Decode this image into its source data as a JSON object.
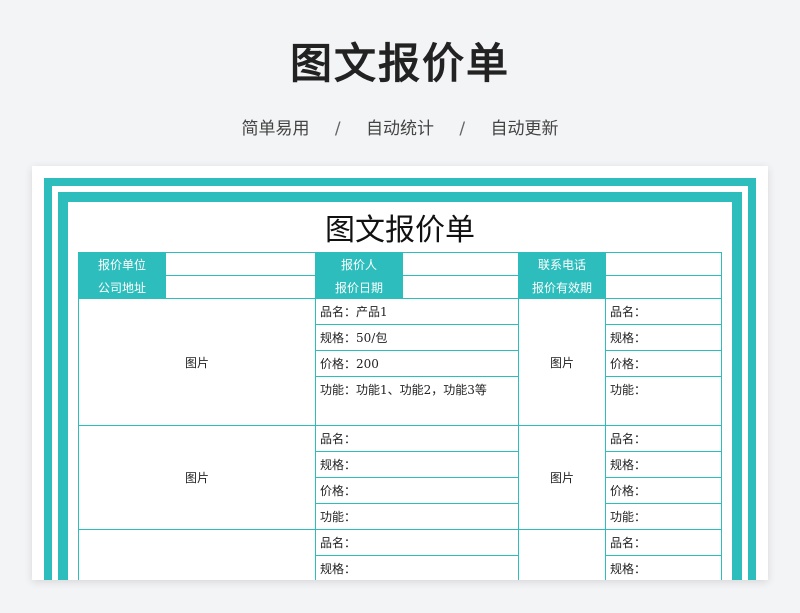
{
  "header": {
    "title": "图文报价单",
    "subtitle_items": [
      "简单易用",
      "自动统计",
      "自动更新"
    ],
    "separator": "/"
  },
  "document": {
    "title": "图文报价单",
    "accent_color": "#2ebdbd",
    "info_rows": [
      [
        "报价单位",
        "",
        "报价人",
        "",
        "联系电话",
        ""
      ],
      [
        "公司地址",
        "",
        "报价日期",
        "",
        "报价有效期",
        ""
      ]
    ],
    "products": [
      {
        "left": {
          "image_label": "图片",
          "name": "品名：产品1",
          "spec": "规格：50/包",
          "price": "价格：200",
          "func": "功能：功能1、功能2，功能3等"
        },
        "right": {
          "image_label": "图片",
          "name": "品名：",
          "spec": "规格：",
          "price": "价格：",
          "func": "功能："
        }
      },
      {
        "left": {
          "image_label": "图片",
          "name": "品名：",
          "spec": "规格：",
          "price": "价格：",
          "func": "功能："
        },
        "right": {
          "image_label": "图片",
          "name": "品名：",
          "spec": "规格：",
          "price": "价格：",
          "func": "功能："
        }
      },
      {
        "left": {
          "image_label": "",
          "name": "品名：",
          "spec": "规格：",
          "price": "",
          "func": ""
        },
        "right": {
          "image_label": "",
          "name": "品名：",
          "spec": "规格：",
          "price": "",
          "func": ""
        }
      }
    ]
  }
}
